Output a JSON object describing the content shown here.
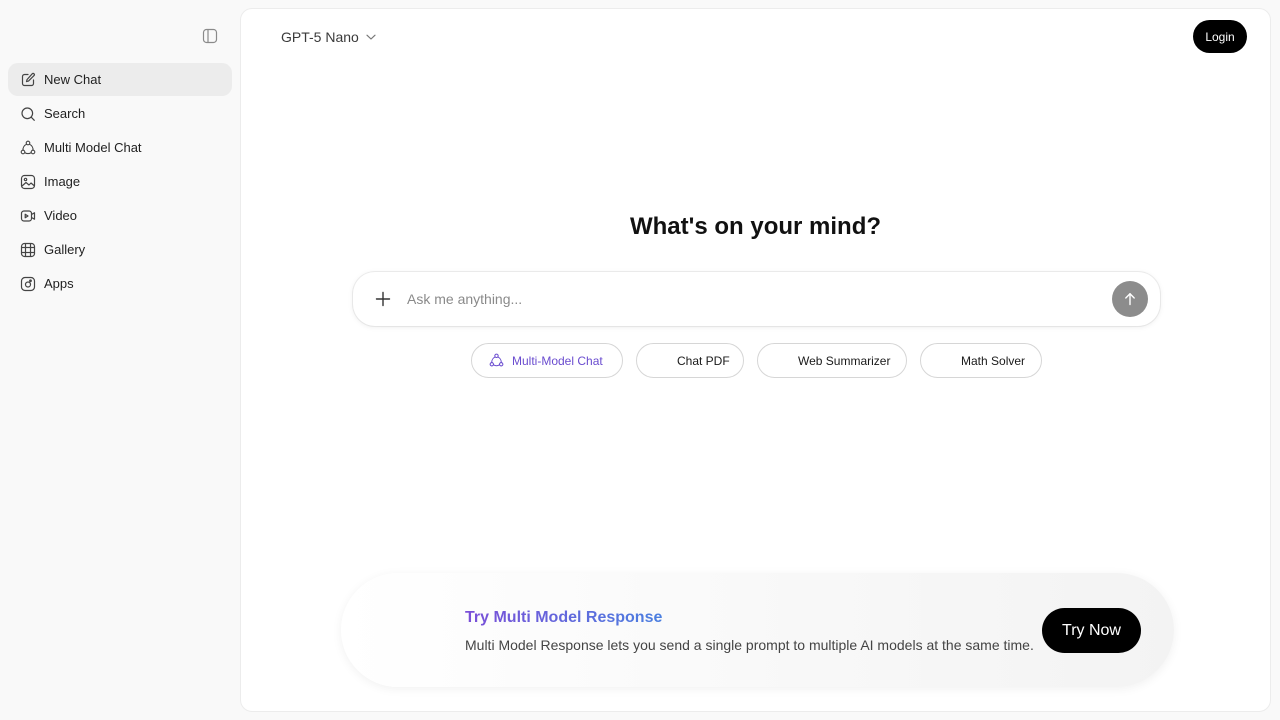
{
  "sidebar": {
    "toggle_icon": "sidebar-toggle-icon",
    "items": [
      {
        "label": "New Chat",
        "icon": "edit-icon",
        "active": true
      },
      {
        "label": "Search",
        "icon": "search-icon",
        "active": false
      },
      {
        "label": "Multi Model Chat",
        "icon": "multi-model-icon",
        "active": false
      },
      {
        "label": "Image",
        "icon": "image-icon",
        "active": false
      },
      {
        "label": "Video",
        "icon": "video-icon",
        "active": false
      },
      {
        "label": "Gallery",
        "icon": "gallery-icon",
        "active": false
      },
      {
        "label": "Apps",
        "icon": "apps-icon",
        "active": false
      }
    ]
  },
  "header": {
    "model_name": "GPT-5 Nano",
    "login_label": "Login"
  },
  "main": {
    "headline": "What's on your mind?",
    "composer_placeholder": "Ask me anything...",
    "chips": [
      {
        "label": "Multi-Model Chat",
        "icon": "multi-model-icon"
      },
      {
        "label": "Chat PDF"
      },
      {
        "label": "Web Summarizer"
      },
      {
        "label": "Math Solver"
      }
    ]
  },
  "promo": {
    "title": "Try Multi Model Response",
    "description": "Multi Model Response lets you send a single prompt to multiple AI models at the same time.",
    "button_label": "Try Now"
  },
  "colors": {
    "accent_purple": "#6a4ccf",
    "accent_blue": "#4a7fe0",
    "button_black": "#000000",
    "send_gray": "#8c8c8c"
  }
}
